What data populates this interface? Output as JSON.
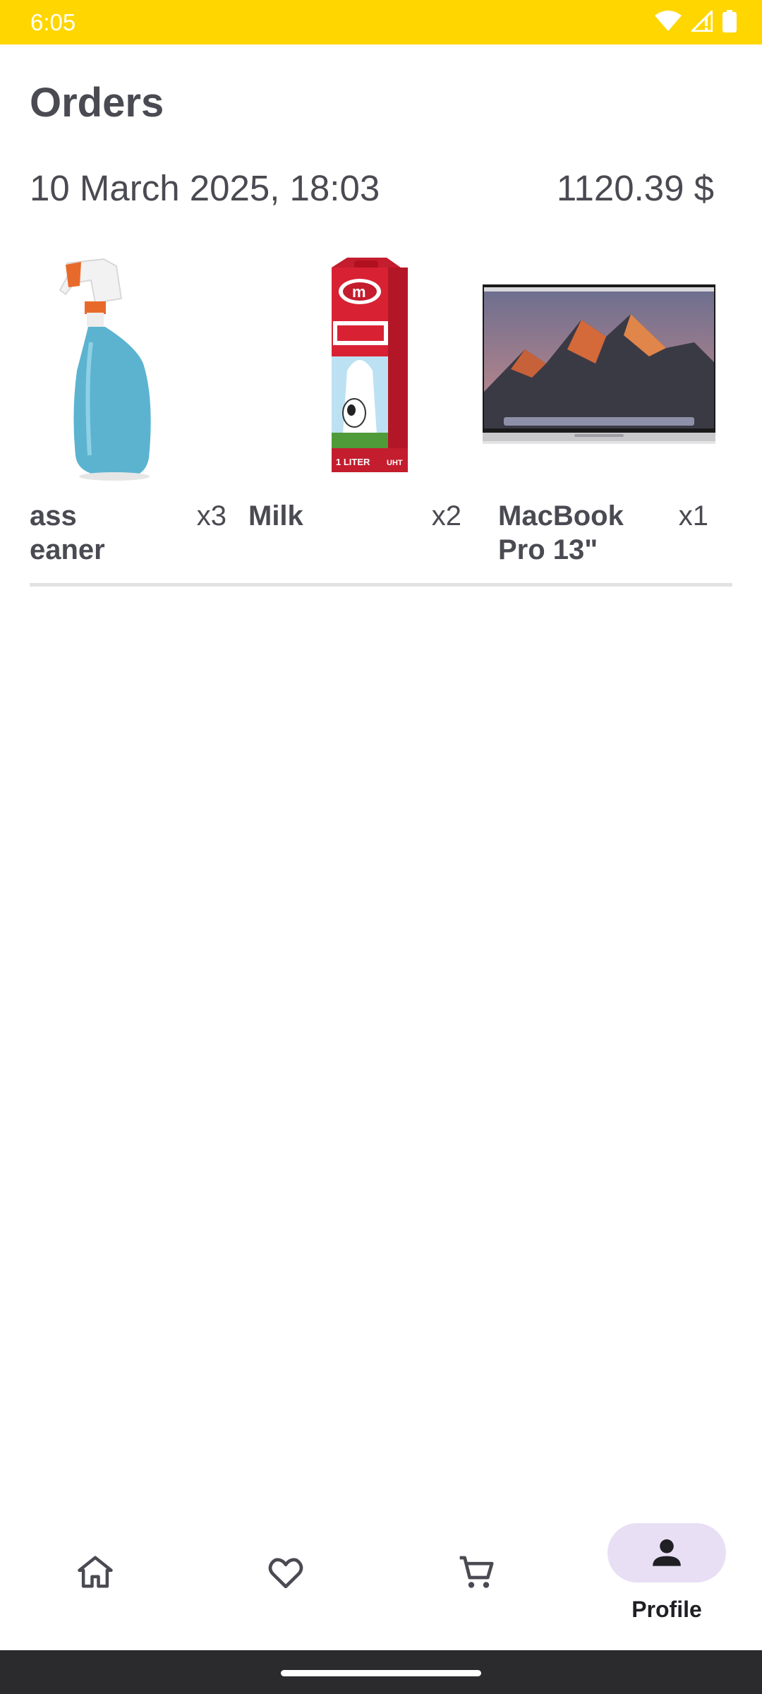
{
  "status_bar": {
    "time": "6:05",
    "icons": [
      "wifi-icon",
      "signal-icon",
      "battery-icon"
    ]
  },
  "page": {
    "title": "Orders"
  },
  "order": {
    "date": "10 March 2025, 18:03",
    "total": "1120.39 $",
    "items": [
      {
        "name": "Glass Cleaner",
        "visible_name": "ass\neaner",
        "quantity": "x3"
      },
      {
        "name": "Milk",
        "visible_name": "Milk",
        "quantity": "x2"
      },
      {
        "name": "MacBook Pro 13\"",
        "visible_name": "MacBook Pro 13\"",
        "quantity": "x1"
      }
    ]
  },
  "nav": {
    "items": [
      {
        "icon": "home-icon"
      },
      {
        "icon": "heart-icon"
      },
      {
        "icon": "cart-icon"
      },
      {
        "icon": "profile-icon",
        "label": "Profile",
        "selected": true
      }
    ]
  },
  "colors": {
    "status_bar": "#FFD600",
    "selected_pill": "#E8DFF5",
    "text": "#4A4A52"
  }
}
